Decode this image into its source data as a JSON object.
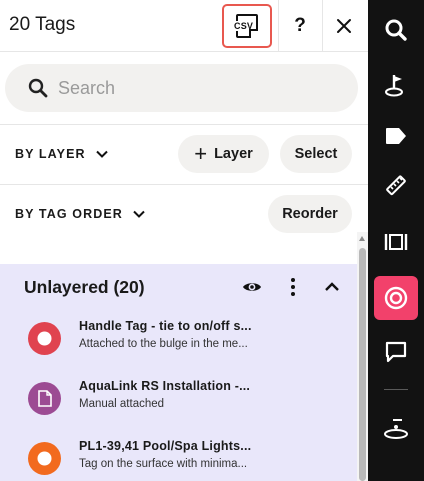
{
  "header": {
    "title": "20 Tags",
    "csv_label": "CSV",
    "help_label": "?"
  },
  "search": {
    "placeholder": "Search",
    "value": ""
  },
  "filters": {
    "by_layer_label": "BY LAYER",
    "add_layer_label": "Layer",
    "select_label": "Select",
    "by_tag_order_label": "BY TAG ORDER",
    "reorder_label": "Reorder"
  },
  "group": {
    "title": "Unlayered (20)",
    "background_color": "#e9e7fa"
  },
  "tags": [
    {
      "title": "Handle Tag - tie to on/off s...",
      "subtitle": "Attached to the bulge in the me...",
      "icon": "dot-marker-icon",
      "color": "#e0434f"
    },
    {
      "title": "AquaLink RS Installation -...",
      "subtitle": "Manual attached",
      "icon": "document-icon",
      "color": "#9c4b93"
    },
    {
      "title": "PL1-39,41 Pool/Spa Lights...",
      "subtitle": "Tag on the surface with minima...",
      "icon": "dot-marker-icon",
      "color": "#f26a1e"
    }
  ],
  "rail": {
    "items": [
      {
        "icon": "search-icon",
        "active": false
      },
      {
        "icon": "tag-pin-icon",
        "active": false
      },
      {
        "icon": "tag-icon",
        "active": false
      },
      {
        "icon": "ruler-icon",
        "active": false
      },
      {
        "icon": "scan-frame-icon",
        "active": false
      },
      {
        "icon": "target-rings-icon",
        "active": true
      },
      {
        "icon": "comment-icon",
        "active": false
      },
      {
        "icon": "floor-level-icon",
        "active": false
      }
    ],
    "active_color": "#f2416b"
  }
}
